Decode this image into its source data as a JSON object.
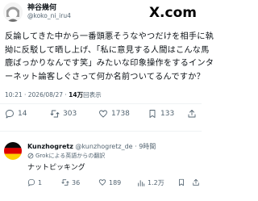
{
  "tweet": {
    "author_name": "神谷幾何",
    "author_handle": "@koko_ni_iru4",
    "text_lines": [
      "反論してきた中から一番頭悪そうなやつだけを相手に執",
      "拗に反駁して晒し上げ、「私に意見する人間はこんな馬",
      "鹿ばっかりなんです笑」みたいな印象操作をするインタ",
      "ーネット論客しぐさって何か名前ついてるんですか？"
    ],
    "timestamp": "10:21 · 2026/08/27 · ",
    "views": "14万",
    "views_suffix": "回表示",
    "metrics": {
      "replies": "14",
      "retweets": "303",
      "likes": "1738",
      "bookmarks": "133"
    }
  },
  "brand": {
    "logo_text": "X.com"
  },
  "reply": {
    "author_name": "Kunzhogretz",
    "author_handle": "@kunzhogretz_de",
    "time": " · 9時間",
    "translated_label": "Grokによる英語からの翻訳",
    "text": "ナットピッキング",
    "metrics": {
      "replies": "1",
      "retweets": "36",
      "likes": "189",
      "views": "1.2万"
    }
  },
  "colors": {
    "text": "#0f1419",
    "secondary": "#536471",
    "divider": "#eff3f4"
  }
}
